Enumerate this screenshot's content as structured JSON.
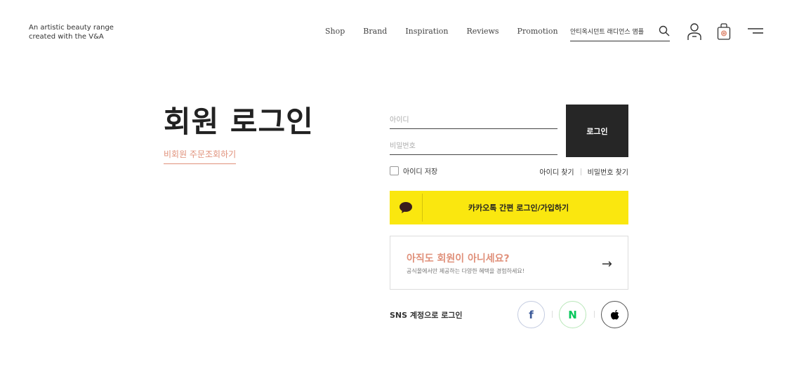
{
  "header": {
    "tagline_line1": "An artistic beauty range",
    "tagline_line2": "created with the V&A",
    "nav": [
      "Shop",
      "Brand",
      "Inspiration",
      "Reviews",
      "Promotion"
    ],
    "search_value": "안티옥시던트 래디언스 앰플",
    "icons": [
      "search-icon",
      "user-icon",
      "bag-icon",
      "menu-icon"
    ]
  },
  "main": {
    "title": "회원 로그인",
    "guest_link": "비회원 주문조회하기",
    "id_placeholder": "아이디",
    "pw_placeholder": "비밀번호",
    "login_button": "로그인",
    "remember_label": "아이디 저장",
    "find_id": "아이디 찾기",
    "find_pw": "비밀번호 찾기",
    "kakao_label": "카카오톡 간편 로그인/가입하기",
    "join_title": "아직도 회원이 아니세요?",
    "join_sub": "공식몰에서만 제공하는 다양한 혜택을 경험하세요!",
    "join_arrow": "→",
    "sns_label": "SNS 계정으로 로그인",
    "sns": {
      "facebook": "f",
      "naver": "N"
    }
  },
  "colors": {
    "accent": "#e0907a",
    "kakao": "#fae70f",
    "dark_button": "#262626",
    "naver": "#03c75a",
    "facebook": "#3b5998"
  }
}
